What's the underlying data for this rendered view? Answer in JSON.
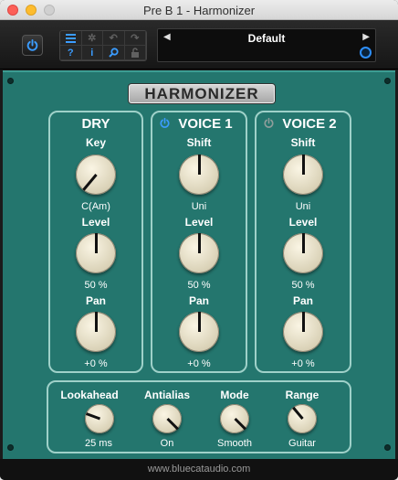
{
  "window": {
    "title": "Pre B 1 - Harmonizer"
  },
  "toolbar": {
    "preset_name": "Default",
    "prev_arrow": "◀",
    "next_arrow": "▶",
    "help_label": "?",
    "info_label": "i"
  },
  "plugin": {
    "title": "HARMONIZER",
    "dry": {
      "header": "DRY",
      "key_label": "Key",
      "key_value": "C(Am)",
      "level_label": "Level",
      "level_value": "50 %",
      "pan_label": "Pan",
      "pan_value": "+0 %"
    },
    "voice1": {
      "header": "VOICE 1",
      "enabled": true,
      "shift_label": "Shift",
      "shift_value": "Uni",
      "level_label": "Level",
      "level_value": "50 %",
      "pan_label": "Pan",
      "pan_value": "+0 %"
    },
    "voice2": {
      "header": "VOICE 2",
      "enabled": false,
      "shift_label": "Shift",
      "shift_value": "Uni",
      "level_label": "Level",
      "level_value": "50 %",
      "pan_label": "Pan",
      "pan_value": "+0 %"
    },
    "global": {
      "lookahead_label": "Lookahead",
      "lookahead_value": "25 ms",
      "antialias_label": "Antialias",
      "antialias_value": "On",
      "mode_label": "Mode",
      "mode_value": "Smooth",
      "range_label": "Range",
      "range_value": "Guitar"
    }
  },
  "footer": {
    "url": "www.bluecataudio.com"
  },
  "colors": {
    "accent": "#3b9cff",
    "panel": "#24766e",
    "section_border": "#9fd1c9"
  }
}
